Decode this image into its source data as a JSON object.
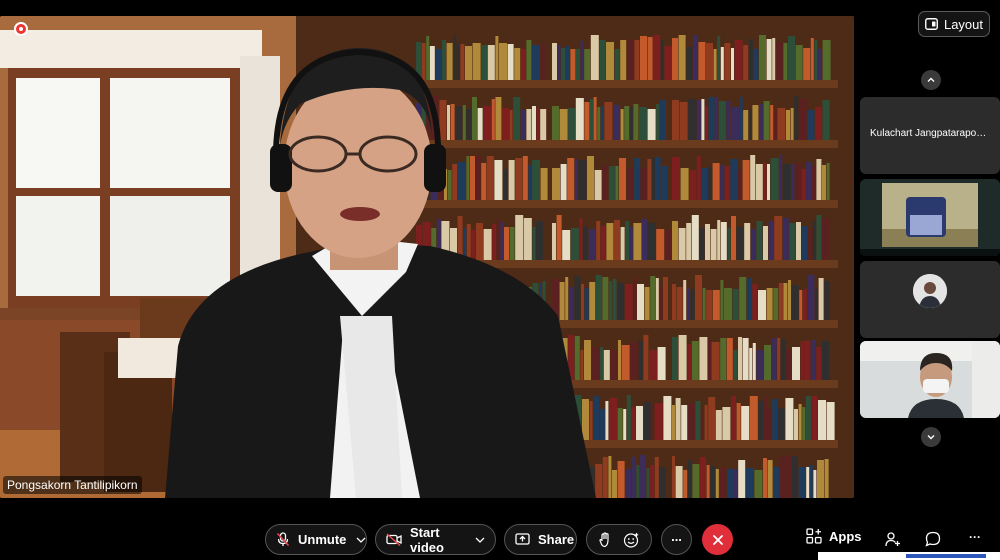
{
  "main_video": {
    "speaker_name": "Pongsakorn Tantilipikorn"
  },
  "header": {
    "layout_label": "Layout"
  },
  "participants": [
    {
      "name": "Kulachart Jangpatarapon..."
    }
  ],
  "toolbar": {
    "unmute_label": "Unmute",
    "start_video_label": "Start video",
    "share_label": "Share",
    "apps_label": "Apps",
    "more_icon": "...",
    "overflow_icon": "···"
  },
  "colors": {
    "end_call": "#e02f3a",
    "toolbar_bg": "#000000",
    "pill_bg": "#141414",
    "tile_bg": "#2c2c2c"
  }
}
